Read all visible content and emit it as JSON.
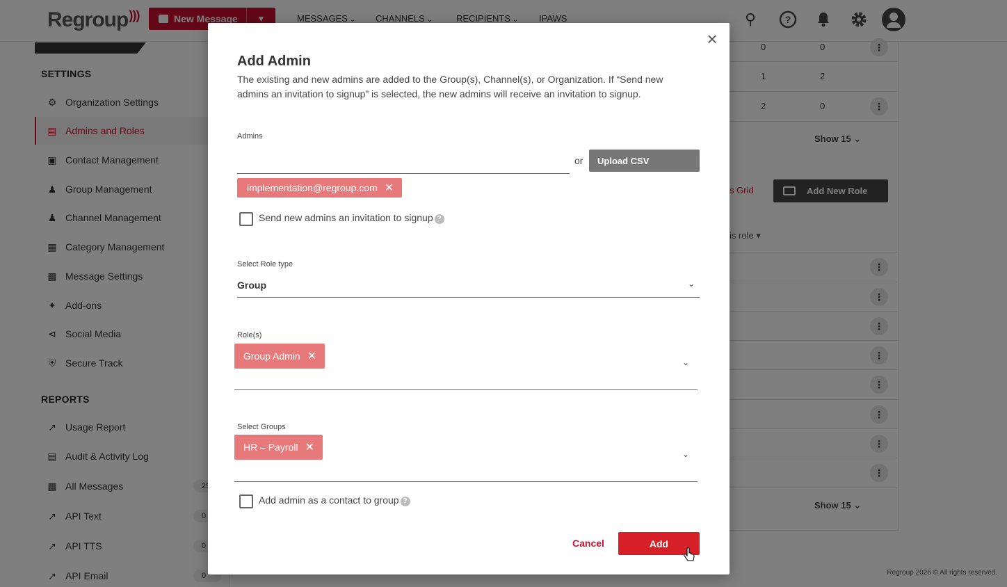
{
  "header": {
    "logo": "Regroup",
    "new_message": "New Message",
    "nav": [
      "MESSAGES",
      "CHANNELS",
      "RECIPIENTS",
      "IPAWS"
    ]
  },
  "sidebar": {
    "settings_heading": "SETTINGS",
    "settings_items": [
      {
        "label": "Organization Settings",
        "icon": "gear-icon"
      },
      {
        "label": "Admins and Roles",
        "icon": "admin-card-icon",
        "active": true
      },
      {
        "label": "Contact Management",
        "icon": "contact-icon"
      },
      {
        "label": "Group Management",
        "icon": "group-icon"
      },
      {
        "label": "Channel Management",
        "icon": "channel-icon"
      },
      {
        "label": "Category Management",
        "icon": "category-icon"
      },
      {
        "label": "Message Settings",
        "icon": "chat-icon"
      },
      {
        "label": "Add-ons",
        "icon": "puzzle-icon"
      },
      {
        "label": "Social Media",
        "icon": "share-icon"
      },
      {
        "label": "Secure Track",
        "icon": "shield-icon"
      }
    ],
    "reports_heading": "REPORTS",
    "report_items": [
      {
        "label": "Usage Report",
        "icon": "trend-icon",
        "count": ""
      },
      {
        "label": "Audit & Activity Log",
        "icon": "log-icon",
        "count": ""
      },
      {
        "label": "All Messages",
        "icon": "chat-icon",
        "count": "25"
      },
      {
        "label": "API Text",
        "icon": "arrow-up-right-icon",
        "count": "0"
      },
      {
        "label": "API TTS",
        "icon": "arrow-up-right-icon",
        "count": "0"
      },
      {
        "label": "API Email",
        "icon": "arrow-up-right-icon",
        "count": "0"
      }
    ]
  },
  "background": {
    "rows_top": [
      [
        "0",
        "0"
      ],
      [
        "1",
        "2"
      ],
      [
        "2",
        "0"
      ]
    ],
    "show_label": "Show 15",
    "grid_link": "s Grid",
    "add_new_role": "Add New Role",
    "role_header": "is role",
    "footer": "Regroup 2026 © All rights reserved."
  },
  "modal": {
    "title": "Add Admin",
    "description": "The existing and new admins are added to the Group(s), Channel(s), or Organization. If “Send new admins an invitation to signup” is selected, the new admins will receive an invitation to signup.",
    "admins_label": "Admins",
    "admins_value": "",
    "or_text": "or",
    "upload_csv": "Upload CSV",
    "admin_chip": "implementation@regroup.com",
    "send_invite_label": "Send new admins an invitation to signup",
    "send_invite_checked": false,
    "role_type_label": "Select Role type",
    "role_type_value": "Group",
    "roles_label": "Role(s)",
    "role_chip": "Group Admin",
    "groups_label": "Select Groups",
    "group_chip": "HR – Payroll",
    "add_contact_label": "Add admin as a contact to group",
    "add_contact_checked": false,
    "cancel": "Cancel",
    "add": "Add"
  },
  "colors": {
    "brand_red": "#c8102e",
    "chip": "#e8797a",
    "add_button": "#d61f26"
  }
}
